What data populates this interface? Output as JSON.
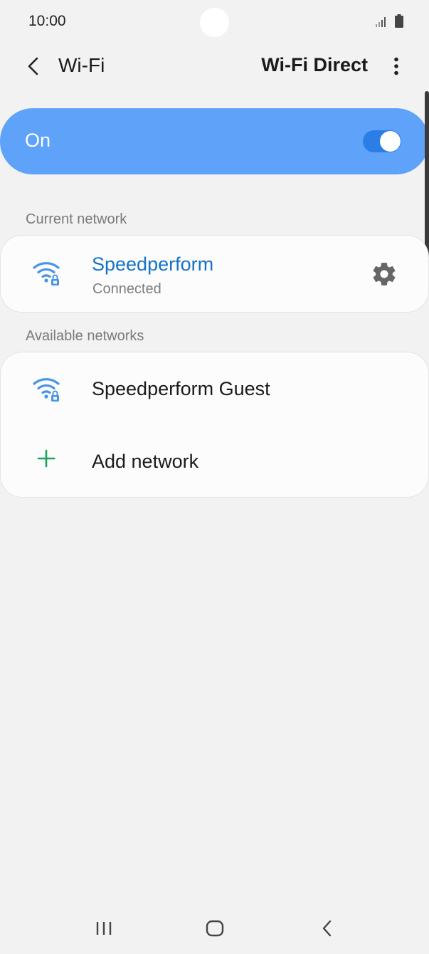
{
  "status_bar": {
    "time": "10:00",
    "icons": [
      "signal-icon",
      "battery-icon"
    ]
  },
  "header": {
    "back_icon": "chevron-left-icon",
    "title": "Wi-Fi",
    "wifi_direct_label": "Wi-Fi Direct",
    "more_icon": "more-vertical-icon"
  },
  "master_switch": {
    "label": "On",
    "state": true
  },
  "current_network": {
    "section_label": "Current network",
    "name": "Speedperform",
    "status": "Connected",
    "icon": "wifi-lock-icon",
    "settings_icon": "gear-icon"
  },
  "available_networks": {
    "section_label": "Available networks",
    "items": [
      {
        "name": "Speedperform Guest",
        "icon": "wifi-lock-icon"
      }
    ],
    "add_network": {
      "label": "Add network",
      "icon": "plus-icon"
    }
  },
  "nav_bar": {
    "buttons": [
      "recent-apps-icon",
      "home-icon",
      "back-icon"
    ]
  },
  "colors": {
    "background": "#f2f2f2",
    "master_switch": "#5ea3f9",
    "toggle_track": "#2a7ee6",
    "connected_text": "#1473c9",
    "wifi_icon": "#4a94e8",
    "plus_icon": "#1aa35a",
    "card": "#fcfcfc"
  }
}
